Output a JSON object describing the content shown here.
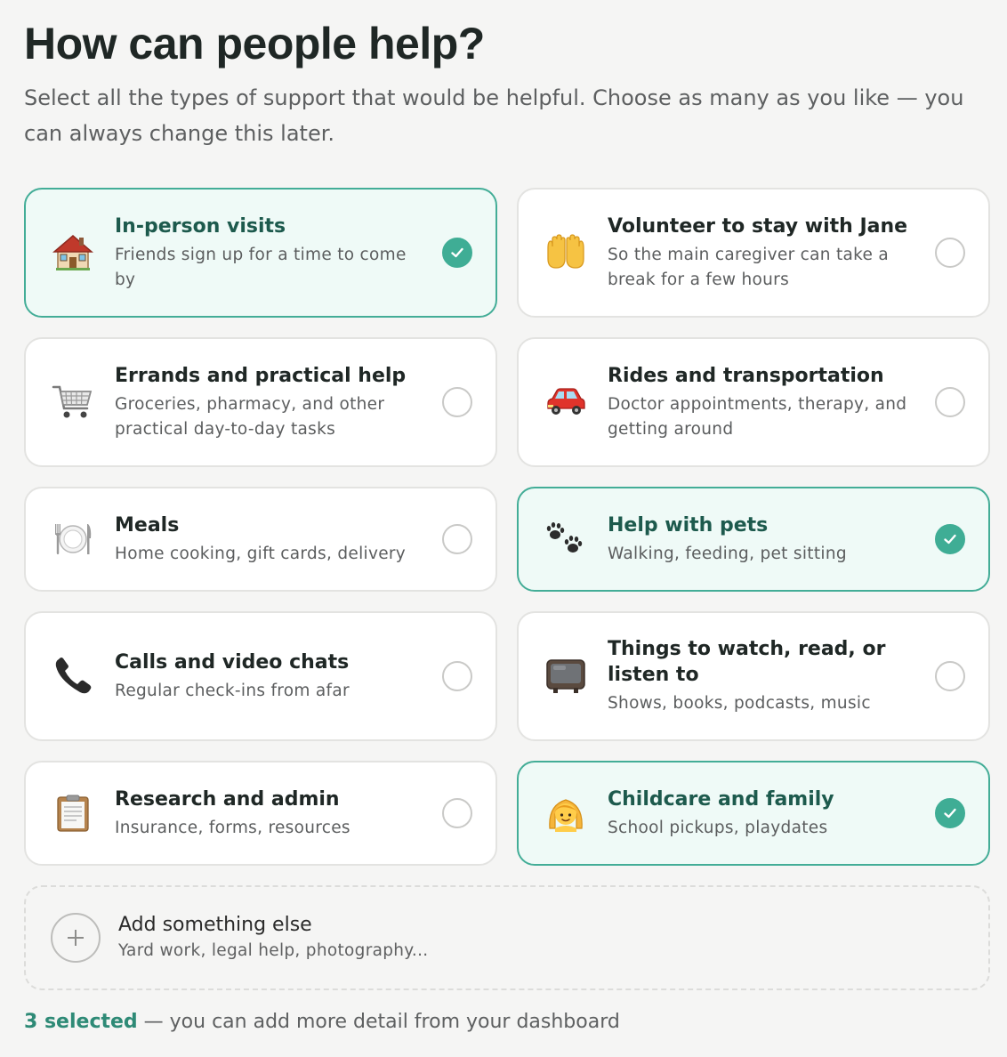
{
  "header": {
    "title": "How can people help?",
    "subtitle": "Select all the types of support that would be helpful. Choose as many as you like — you can always change this later."
  },
  "options": [
    {
      "icon": "house-icon",
      "title": "In-person visits",
      "description": "Friends sign up for a time to come by",
      "selected": true
    },
    {
      "icon": "raised-hands-icon",
      "title": "Volunteer to stay with Jane",
      "description": "So the main caregiver can take a break for a few hours",
      "selected": false
    },
    {
      "icon": "shopping-cart-icon",
      "title": "Errands and practical help",
      "description": "Groceries, pharmacy, and other practical day-to-day tasks",
      "selected": false
    },
    {
      "icon": "car-icon",
      "title": "Rides and transportation",
      "description": "Doctor appointments, therapy, and getting around",
      "selected": false
    },
    {
      "icon": "plate-cutlery-icon",
      "title": "Meals",
      "description": "Home cooking, gift cards, delivery",
      "selected": false
    },
    {
      "icon": "paw-prints-icon",
      "title": "Help with pets",
      "description": "Walking, feeding, pet sitting",
      "selected": true
    },
    {
      "icon": "telephone-icon",
      "title": "Calls and video chats",
      "description": "Regular check-ins from afar",
      "selected": false
    },
    {
      "icon": "television-icon",
      "title": "Things to watch, read, or listen to",
      "description": "Shows, books, podcasts, music",
      "selected": false
    },
    {
      "icon": "clipboard-icon",
      "title": "Research and admin",
      "description": "Insurance, forms, resources",
      "selected": false
    },
    {
      "icon": "child-icon",
      "title": "Childcare and family",
      "description": "School pickups, playdates",
      "selected": true
    }
  ],
  "add_option": {
    "title": "Add something else",
    "description": "Yard work, legal help, photography..."
  },
  "footer": {
    "count_text": "3 selected",
    "rest_text": " — you can add more detail from your dashboard"
  },
  "colors": {
    "accent": "#3fad95",
    "selected_bg": "#effaf7",
    "selected_title": "#1d5a4d"
  }
}
